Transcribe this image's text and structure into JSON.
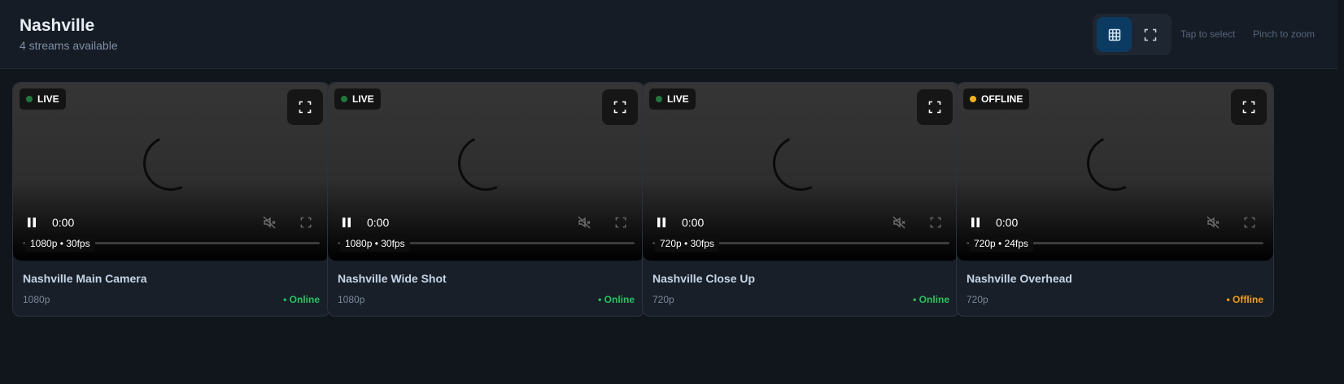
{
  "header": {
    "title": "Nashville",
    "subtitle": "4 streams available",
    "view_toggle": {
      "grid_icon": "grid-icon",
      "single_icon": "expand-icon",
      "active": "grid"
    },
    "hints": [
      "Tap to select",
      "Pinch to zoom"
    ]
  },
  "colors": {
    "live_dot": "#1f7a3a",
    "offline_dot": "#f5b416",
    "online_text": "#22c55e",
    "offline_text": "#f59e0b",
    "grid_active_bg": "#0b3b63"
  },
  "streams": [
    {
      "badge": "LIVE",
      "badge_state": "live",
      "time": "0:00",
      "overlay": "1080p • 30fps",
      "name": "Nashville Main Camera",
      "resolution": "1080p",
      "status": "• Online",
      "status_state": "online"
    },
    {
      "badge": "LIVE",
      "badge_state": "live",
      "time": "0:00",
      "overlay": "1080p • 30fps",
      "name": "Nashville Wide Shot",
      "resolution": "1080p",
      "status": "• Online",
      "status_state": "online"
    },
    {
      "badge": "LIVE",
      "badge_state": "live",
      "time": "0:00",
      "overlay": "720p • 30fps",
      "name": "Nashville Close Up",
      "resolution": "720p",
      "status": "• Online",
      "status_state": "online"
    },
    {
      "badge": "OFFLINE",
      "badge_state": "offline",
      "time": "0:00",
      "overlay": "720p • 24fps",
      "name": "Nashville Overhead",
      "resolution": "720p",
      "status": "• Offline",
      "status_state": "offline"
    }
  ],
  "video_controls": {
    "play_icon": "pause-icon",
    "mute_icon": "volume-muted-icon",
    "fullscreen_icon": "fullscreen-icon"
  }
}
